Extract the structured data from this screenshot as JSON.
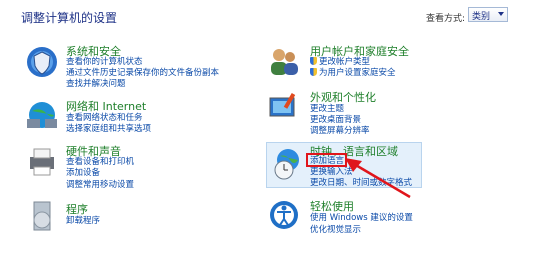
{
  "header": {
    "title": "调整计算机的设置",
    "view_by_label": "查看方式:",
    "view_by_value": "类别"
  },
  "categories": [
    {
      "title": "系统和安全",
      "links": [
        "查看你的计算机状态",
        "通过文件历史记录保存你的文件备份副本",
        "查找并解决问题"
      ]
    },
    {
      "title": "网络和 Internet",
      "links": [
        "查看网络状态和任务",
        "选择家庭组和共享选项"
      ]
    },
    {
      "title": "硬件和声音",
      "links": [
        "查看设备和打印机",
        "添加设备",
        "调整常用移动设置"
      ]
    },
    {
      "title": "程序",
      "links": [
        "卸载程序"
      ]
    },
    {
      "title": "用户帐户和家庭安全",
      "links": [
        "更改帐户类型",
        "为用户设置家庭安全"
      ]
    },
    {
      "title": "外观和个性化",
      "links": [
        "更改主题",
        "更改桌面背景",
        "调整屏幕分辨率"
      ]
    },
    {
      "title": "时钟、语言和区域",
      "links": [
        "添加语言",
        "更换输入法",
        "更改日期、时间或数字格式"
      ]
    },
    {
      "title": "轻松使用",
      "links": [
        "使用 Windows 建议的设置",
        "优化视觉显示"
      ]
    }
  ],
  "colors": {
    "annotation": "#e0151b",
    "link": "#0b4aa8",
    "category": "#1e7f2a"
  }
}
